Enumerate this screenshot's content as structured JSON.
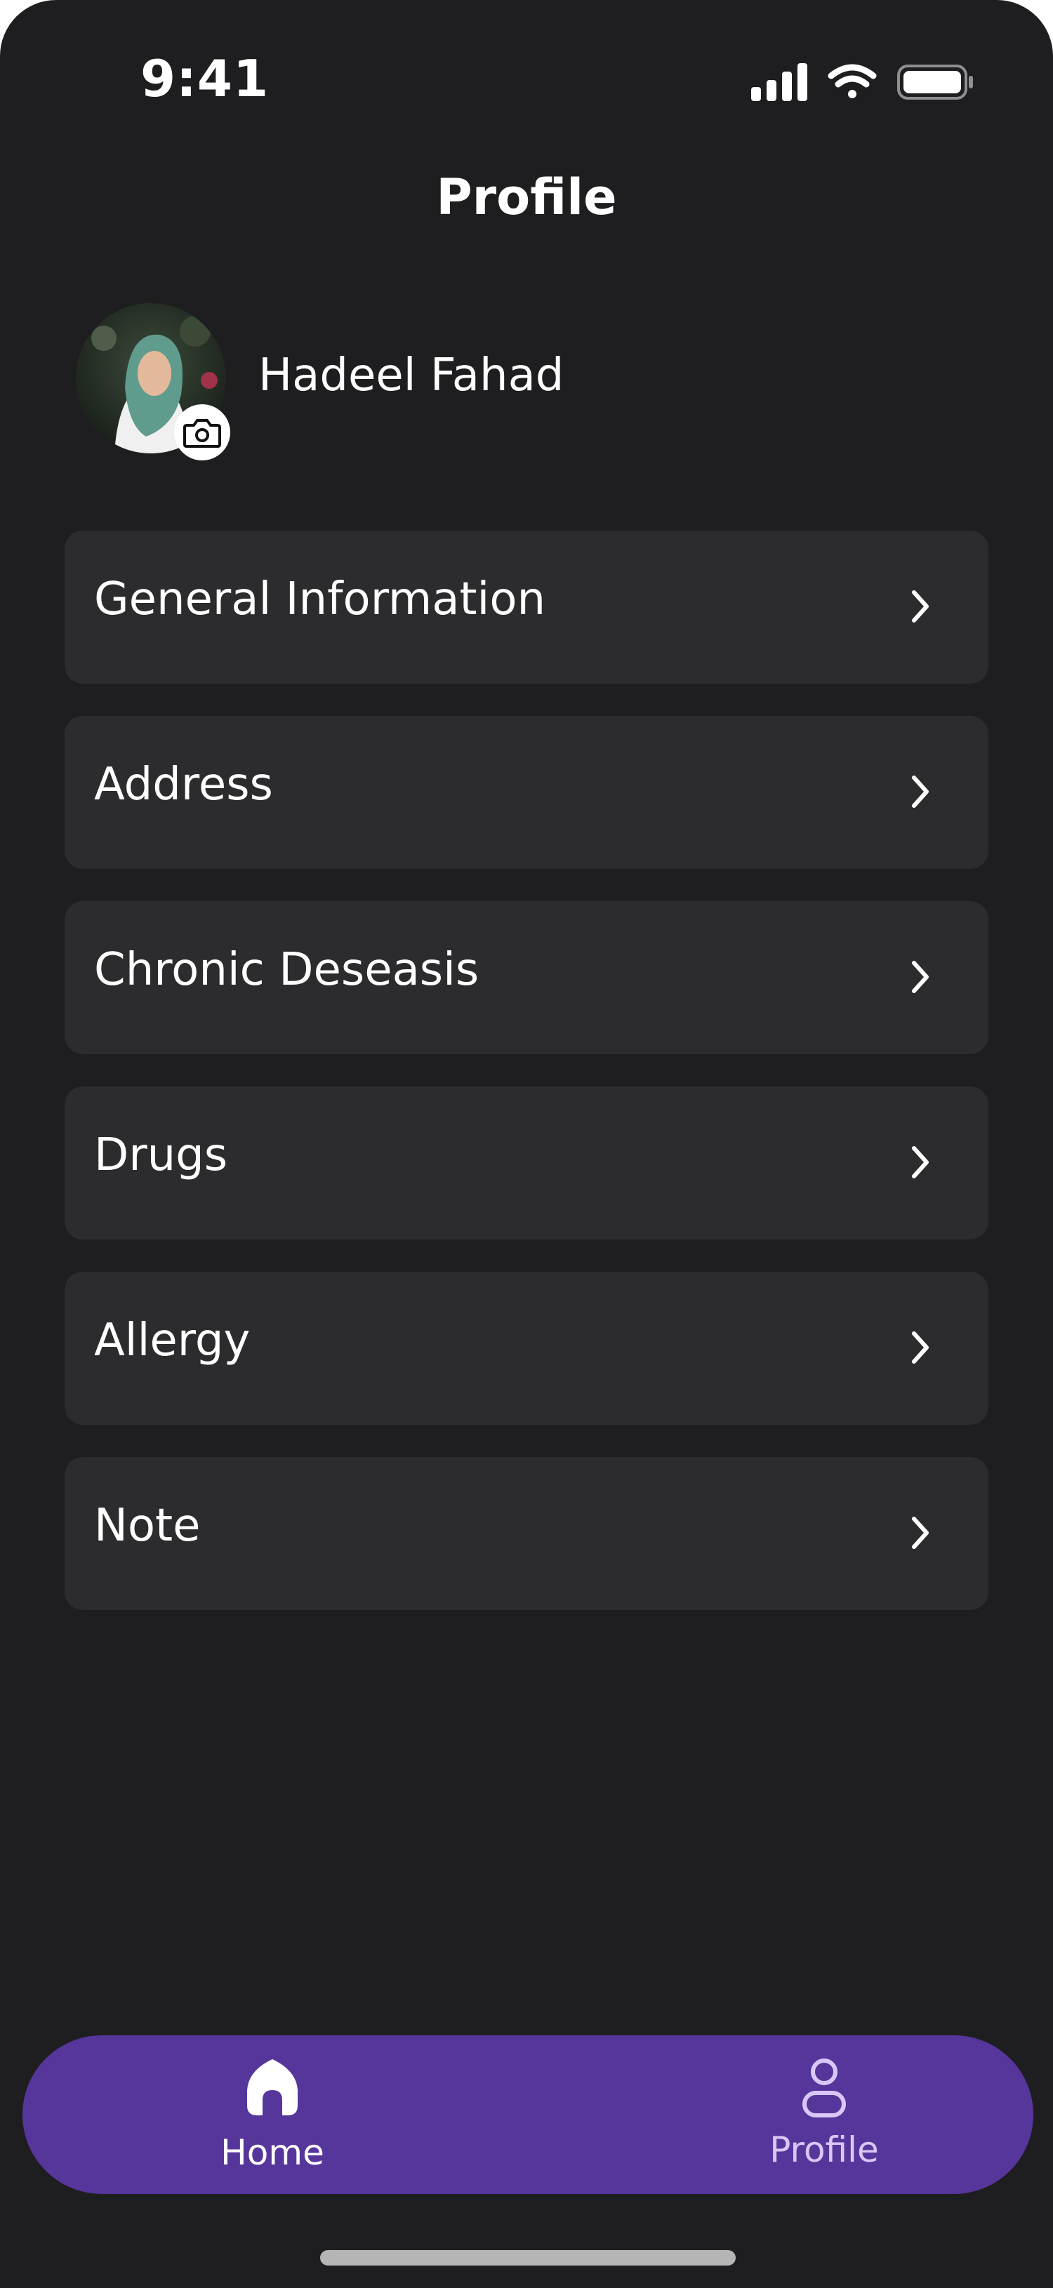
{
  "status_bar": {
    "time": "9:41",
    "icons": [
      "cellular-signal-icon",
      "wifi-icon",
      "battery-icon"
    ]
  },
  "header": {
    "title": "Profile"
  },
  "user": {
    "name": "Hadeel Fahad",
    "avatar_icon": "avatar-photo",
    "badge_icon": "camera-icon"
  },
  "menu": {
    "items": [
      {
        "label": "General Information",
        "icon": "chevron-right-icon"
      },
      {
        "label": "Address",
        "icon": "chevron-right-icon"
      },
      {
        "label": "Chronic Deseasis",
        "icon": "chevron-right-icon"
      },
      {
        "label": "Drugs",
        "icon": "chevron-right-icon"
      },
      {
        "label": "Allergy",
        "icon": "chevron-right-icon"
      },
      {
        "label": "Note",
        "icon": "chevron-right-icon"
      }
    ]
  },
  "bottom_nav": {
    "items": [
      {
        "label": "Home",
        "icon": "home-icon",
        "active": true
      },
      {
        "label": "Profile",
        "icon": "profile-icon",
        "active": false
      }
    ]
  },
  "colors": {
    "background": "#1e1e20",
    "card": "#2c2c2e",
    "nav_background": "#56369b",
    "text": "#ffffff",
    "inactive_nav_text": "#d9c8f7"
  }
}
